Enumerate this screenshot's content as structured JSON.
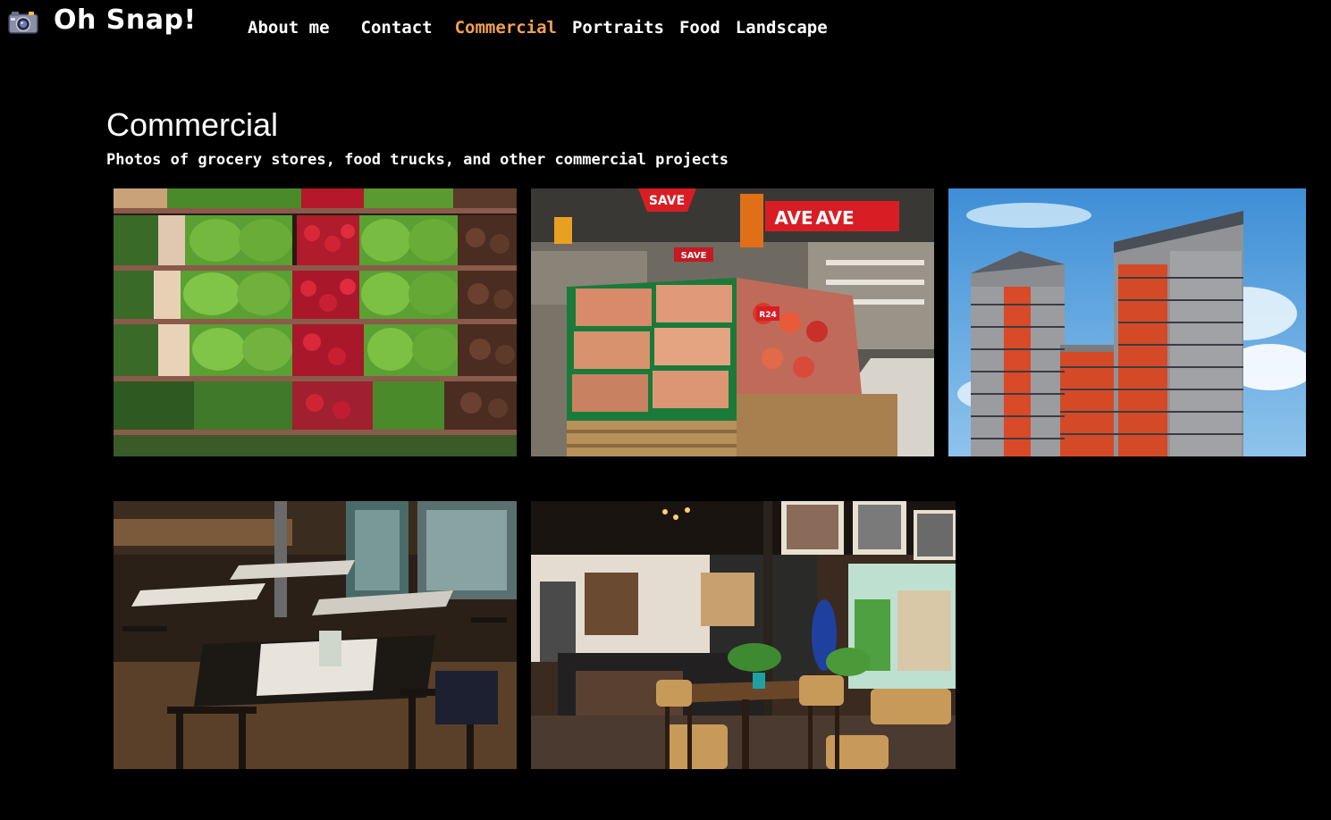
{
  "brand": {
    "title": "Oh Snap!",
    "icon": "camera-icon"
  },
  "nav": {
    "items": [
      {
        "label": "About me",
        "active": false
      },
      {
        "label": "Contact",
        "active": false
      },
      {
        "label": "Commercial",
        "active": true
      },
      {
        "label": "Portraits",
        "active": false
      },
      {
        "label": "Food",
        "active": false
      },
      {
        "label": "Landscape",
        "active": false
      }
    ]
  },
  "section": {
    "title": "Commercial",
    "subtitle": "Photos of grocery stores, food trucks, and other commercial projects"
  },
  "photos": {
    "grocery_produce": {
      "signs": []
    },
    "grocery_fruit_aisle": {
      "signs": [
        "SAVE",
        "AVE",
        "AVE",
        "SAVE",
        "R24"
      ]
    },
    "apartment_building": {
      "signs": []
    },
    "restaurant_interior": {
      "signs": []
    },
    "cafe_interior": {
      "signs": []
    }
  },
  "colors": {
    "background": "#000000",
    "text": "#ffffff",
    "nav_active": "#f2a152"
  }
}
